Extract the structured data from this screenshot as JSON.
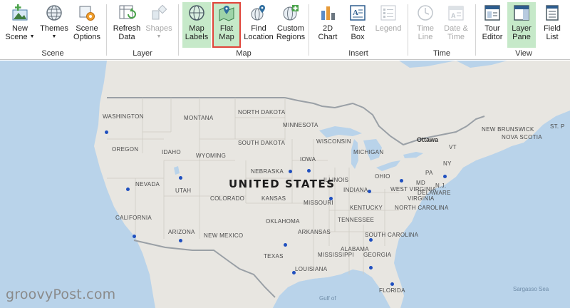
{
  "ribbon": {
    "groups": {
      "scene": "Scene",
      "layer": "Layer",
      "map": "Map",
      "insert": "Insert",
      "time": "Time",
      "view": "View"
    },
    "buttons": {
      "new_scene_1": "New",
      "new_scene_2": "Scene",
      "themes": "Themes",
      "scene_options_1": "Scene",
      "scene_options_2": "Options",
      "refresh_data_1": "Refresh",
      "refresh_data_2": "Data",
      "shapes": "Shapes",
      "map_labels_1": "Map",
      "map_labels_2": "Labels",
      "flat_map_1": "Flat",
      "flat_map_2": "Map",
      "find_location_1": "Find",
      "find_location_2": "Location",
      "custom_regions_1": "Custom",
      "custom_regions_2": "Regions",
      "chart_2d_1": "2D",
      "chart_2d_2": "Chart",
      "text_box_1": "Text",
      "text_box_2": "Box",
      "legend": "Legend",
      "time_line_1": "Time",
      "time_line_2": "Line",
      "date_time_1": "Date &",
      "date_time_2": "Time",
      "tour_editor_1": "Tour",
      "tour_editor_2": "Editor",
      "layer_pane_1": "Layer",
      "layer_pane_2": "Pane",
      "field_list_1": "Field",
      "field_list_2": "List"
    }
  },
  "map": {
    "country": "UNITED STATES",
    "states": {
      "washington": "WASHINGTON",
      "oregon": "OREGON",
      "idaho": "IDAHO",
      "montana": "MONTANA",
      "wyoming": "WYOMING",
      "nevada": "NEVADA",
      "utah": "UTAH",
      "california": "CALIFORNIA",
      "arizona": "ARIZONA",
      "new_mexico": "NEW MEXICO",
      "colorado": "COLORADO",
      "north_dakota": "NORTH DAKOTA",
      "south_dakota": "SOUTH DAKOTA",
      "nebraska": "NEBRASKA",
      "kansas": "KANSAS",
      "oklahoma": "OKLAHOMA",
      "texas": "TEXAS",
      "minnesota": "MINNESOTA",
      "iowa": "IOWA",
      "missouri": "MISSOURI",
      "arkansas": "ARKANSAS",
      "louisiana": "LOUISIANA",
      "wisconsin": "WISCONSIN",
      "illinois": "ILLINOIS",
      "michigan": "MICHIGAN",
      "indiana": "INDIANA",
      "ohio": "OHIO",
      "kentucky": "KENTUCKY",
      "tennessee": "TENNESSEE",
      "mississippi": "MISSISSIPPI",
      "alabama": "ALABAMA",
      "georgia": "GEORGIA",
      "florida": "FLORIDA",
      "south_carolina": "SOUTH CAROLINA",
      "north_carolina": "NORTH CAROLINA",
      "virginia": "VIRGINIA",
      "west_virginia": "WEST VIRGINIA",
      "pennsylvania": "PA",
      "ny": "NY",
      "md": "MD",
      "nj": "N.J.",
      "delaware": "DELAWARE",
      "vermont": "VT",
      "new_brunswick": "NEW BRUNSWICK",
      "nova_scotia": "NOVA SCOTIA",
      "st_pierre": "ST. P",
      "ottawa": "Ottawa"
    },
    "water": {
      "gulf": "Gulf of",
      "sargasso": "Sargasso Sea"
    },
    "watermark": "groovyPost.com",
    "marker_color": "#1f4fbf",
    "land_color": "#e9e7e2",
    "water_color": "#b9d3ea"
  }
}
